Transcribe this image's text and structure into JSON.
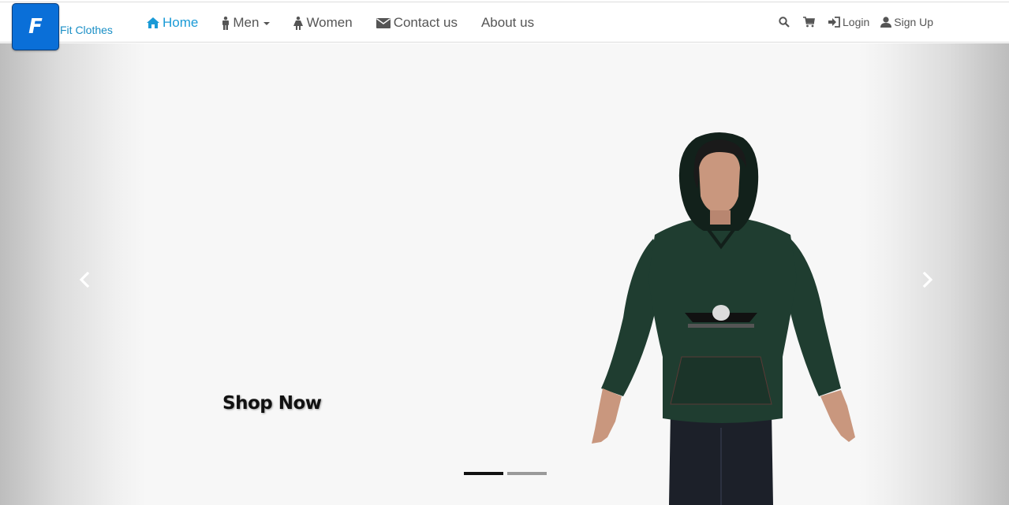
{
  "brand": {
    "logo_letter": "F",
    "name": "Fit Clothes",
    "color": "#0a6fd8"
  },
  "nav": {
    "left": [
      {
        "label": "Home",
        "icon": "home-icon",
        "active": true
      },
      {
        "label": "Men",
        "icon": "male-icon",
        "dropdown": true
      },
      {
        "label": "Women",
        "icon": "female-icon"
      },
      {
        "label": "Contact us",
        "icon": "envelope-icon"
      },
      {
        "label": "About us"
      }
    ],
    "right": [
      {
        "icon": "search-icon"
      },
      {
        "icon": "cart-icon"
      },
      {
        "label": "Login",
        "icon": "login-icon"
      },
      {
        "label": "Sign Up",
        "icon": "user-icon"
      }
    ]
  },
  "carousel": {
    "cta": "Shop Now",
    "prev_icon": "chevron-left-icon",
    "next_icon": "chevron-right-icon",
    "slides": 2,
    "active_slide": 1
  },
  "colors": {
    "accent": "#1a9ad6",
    "hoodie": "#1f3d30"
  }
}
